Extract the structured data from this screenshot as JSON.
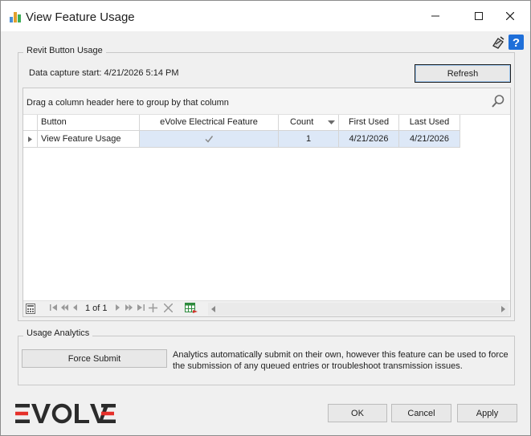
{
  "window": {
    "title": "View Feature Usage",
    "controls": [
      "minimize",
      "maximize",
      "close"
    ]
  },
  "header_icons": [
    "plugin-icon",
    "help-icon"
  ],
  "button_usage": {
    "group_title": "Revit Button Usage",
    "data_capture_label": "Data capture start: 4/21/2026 5:14 PM",
    "refresh_label": "Refresh"
  },
  "grid": {
    "group_panel_hint": "Drag a column header here to group by that column",
    "columns": [
      "Button",
      "eVolve Electrical Feature",
      "Count",
      "First Used",
      "Last Used"
    ],
    "sorted_column": "Count",
    "rows": [
      {
        "button": "View Feature Usage",
        "electrical_feature": true,
        "count": "1",
        "first_used": "4/21/2026",
        "last_used": "4/21/2026"
      }
    ],
    "navigator": {
      "page_text": "1 of 1"
    }
  },
  "analytics": {
    "group_title": "Usage Analytics",
    "force_submit_label": "Force Submit",
    "description": "Analytics automatically submit on their own, however this feature can be used to force the submission of any queued entries or troubleshoot transmission issues."
  },
  "footer": {
    "logo_text": "EVOLVE",
    "ok_label": "OK",
    "cancel_label": "Cancel",
    "apply_label": "Apply"
  },
  "colors": {
    "selection": "#dde8f7",
    "help_blue": "#1e6fd9",
    "logo_dark": "#2b2b2b",
    "logo_red": "#e5302a"
  }
}
